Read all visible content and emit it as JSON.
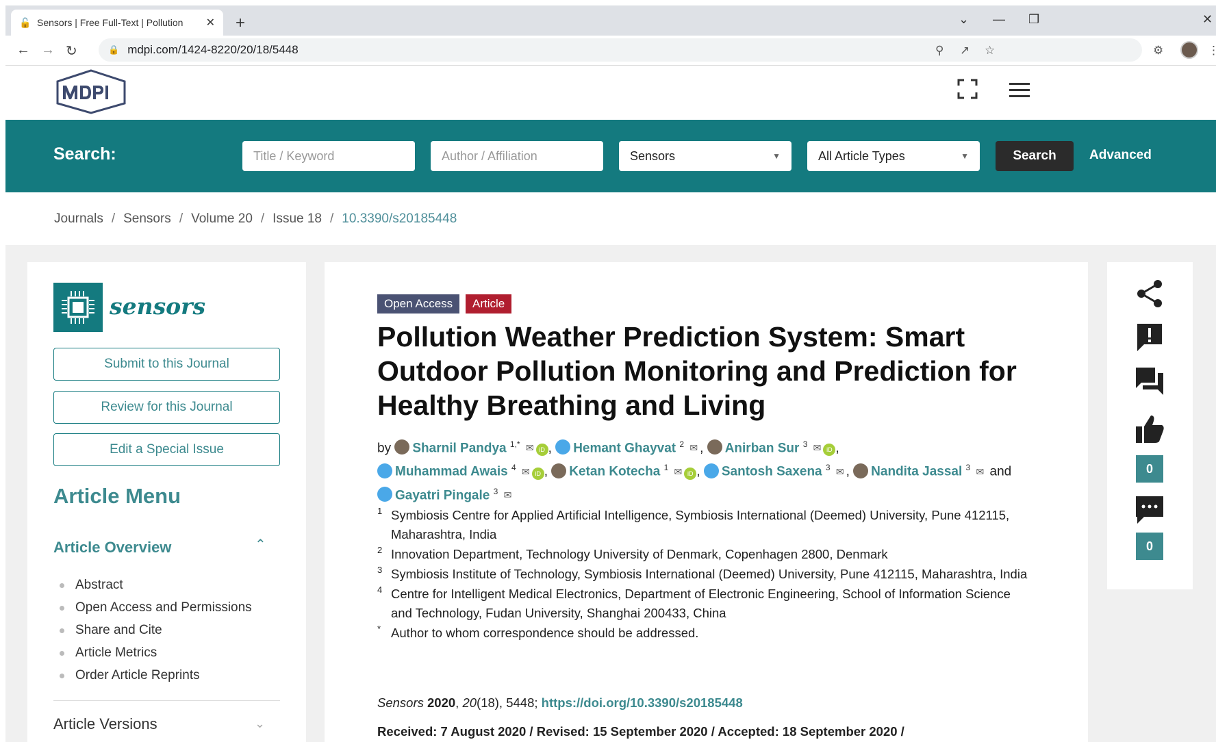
{
  "browser": {
    "tab_title": "Sensors | Free Full-Text | Pollution",
    "url": "mdpi.com/1424-8220/20/18/5448"
  },
  "search": {
    "label": "Search:",
    "title_placeholder": "Title / Keyword",
    "author_placeholder": "Author / Affiliation",
    "journal_selected": "Sensors",
    "type_selected": "All Article Types",
    "button": "Search",
    "advanced": "Advanced"
  },
  "breadcrumb": {
    "items": [
      "Journals",
      "Sensors",
      "Volume 20",
      "Issue 18"
    ],
    "current": "10.3390/s20185448",
    "sep": "/"
  },
  "sidebar": {
    "journal_name": "sensors",
    "buttons": [
      "Submit to this Journal",
      "Review for this Journal",
      "Edit a Special Issue"
    ],
    "menu_title": "Article Menu",
    "overview_title": "Article Overview",
    "overview_items": [
      "Abstract",
      "Open Access and Permissions",
      "Share and Cite",
      "Article Metrics",
      "Order Article Reprints"
    ],
    "versions_title": "Article Versions"
  },
  "article": {
    "badge_open": "Open Access",
    "badge_type": "Article",
    "title": "Pollution Weather Prediction System: Smart Outdoor Pollution Monitoring and Prediction for Healthy Breathing and Living",
    "by": "by",
    "and": "and",
    "authors": [
      {
        "name": "Sharnil Pandya",
        "sup": "1,*"
      },
      {
        "name": "Hemant Ghayvat",
        "sup": "2"
      },
      {
        "name": "Anirban Sur",
        "sup": "3"
      },
      {
        "name": "Muhammad Awais",
        "sup": "4"
      },
      {
        "name": "Ketan Kotecha",
        "sup": "1"
      },
      {
        "name": "Santosh Saxena",
        "sup": "3"
      },
      {
        "name": "Nandita Jassal",
        "sup": "3"
      },
      {
        "name": "Gayatri Pingale",
        "sup": "3"
      }
    ],
    "affiliations": [
      {
        "num": "1",
        "text": "Symbiosis Centre for Applied Artificial Intelligence, Symbiosis International (Deemed) University, Pune 412115, Maharashtra, India"
      },
      {
        "num": "2",
        "text": "Innovation Department, Technology University of Denmark, Copenhagen 2800, Denmark"
      },
      {
        "num": "3",
        "text": "Symbiosis Institute of Technology, Symbiosis International (Deemed) University, Pune 412115, Maharashtra, India"
      },
      {
        "num": "4",
        "text": "Centre for Intelligent Medical Electronics, Department of Electronic Engineering, School of Information Science and Technology, Fudan University, Shanghai 200433, China"
      },
      {
        "num": "*",
        "text": "Author to whom correspondence should be addressed."
      }
    ],
    "citation": {
      "journal": "Sensors",
      "year": "2020",
      "volume": "20",
      "rest": "(18), 5448;",
      "doi": "https://doi.org/10.3390/s20185448"
    },
    "dates": "Received: 7 August 2020 / Revised: 15 September 2020 / Accepted: 18 September 2020 /"
  },
  "right_panel": {
    "likes": "0",
    "comments": "0"
  }
}
